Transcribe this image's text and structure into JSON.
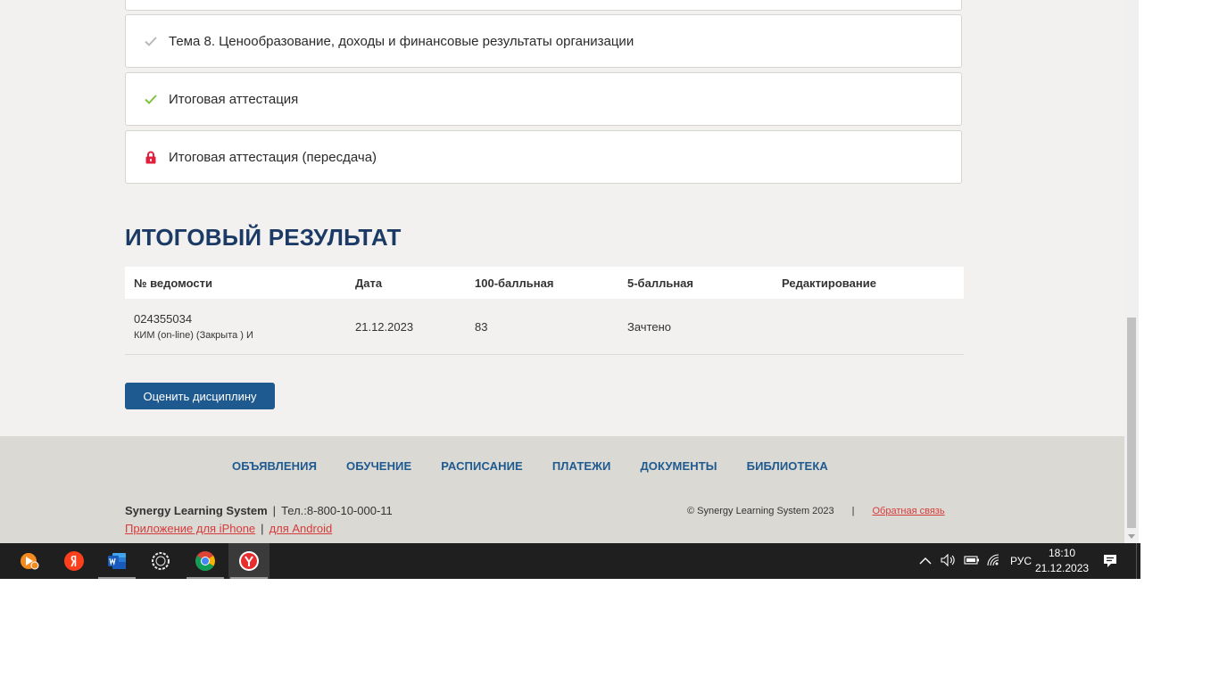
{
  "topics": [
    {
      "label": "Тема 8. Ценообразование, доходы и финансовые результаты организации",
      "status": "done-grey",
      "icon": "check-icon"
    },
    {
      "label": "Итоговая аттестация",
      "status": "done-green",
      "icon": "check-icon"
    },
    {
      "label": "Итоговая аттестация (пересдача)",
      "status": "locked",
      "icon": "lock-icon"
    }
  ],
  "results": {
    "title": "ИТОГОВЫЙ РЕЗУЛЬТАТ",
    "headers": [
      "№ ведомости",
      "Дата",
      "100-балльная",
      "5-балльная",
      "Редактирование"
    ],
    "rows": [
      {
        "number": "024355034",
        "subtitle": "КИМ (on-line) (Закрыта ) И",
        "date": "21.12.2023",
        "score100": "83",
        "score5": "Зачтено",
        "edit": ""
      }
    ],
    "rate_button": "Оценить дисциплину"
  },
  "footer": {
    "nav": [
      "ОБЪЯВЛЕНИЯ",
      "ОБУЧЕНИЕ",
      "РАСПИСАНИЕ",
      "ПЛАТЕЖИ",
      "ДОКУМЕНТЫ",
      "БИБЛИОТЕКА"
    ],
    "brand": "Synergy Learning System",
    "phone": "Тел.:8-800-10-000-11",
    "sep": "|",
    "app_iphone": "Приложение для iPhone",
    "app_android": "для Android",
    "copyright": "© Synergy Learning System 2023",
    "feedback": "Обратная связь"
  },
  "taskbar": {
    "apps": [
      "media-player-icon",
      "yandex-icon",
      "word-icon",
      "circle-app-icon",
      "chrome-icon",
      "yandex-browser-icon"
    ],
    "language": "РУС",
    "time": "18:10",
    "date": "21.12.2023"
  },
  "colors": {
    "accent": "#1e5a90",
    "title": "#1b3a66",
    "link": "#d63b3b",
    "check_green": "#7cc33f",
    "lock_red": "#e0203f"
  }
}
